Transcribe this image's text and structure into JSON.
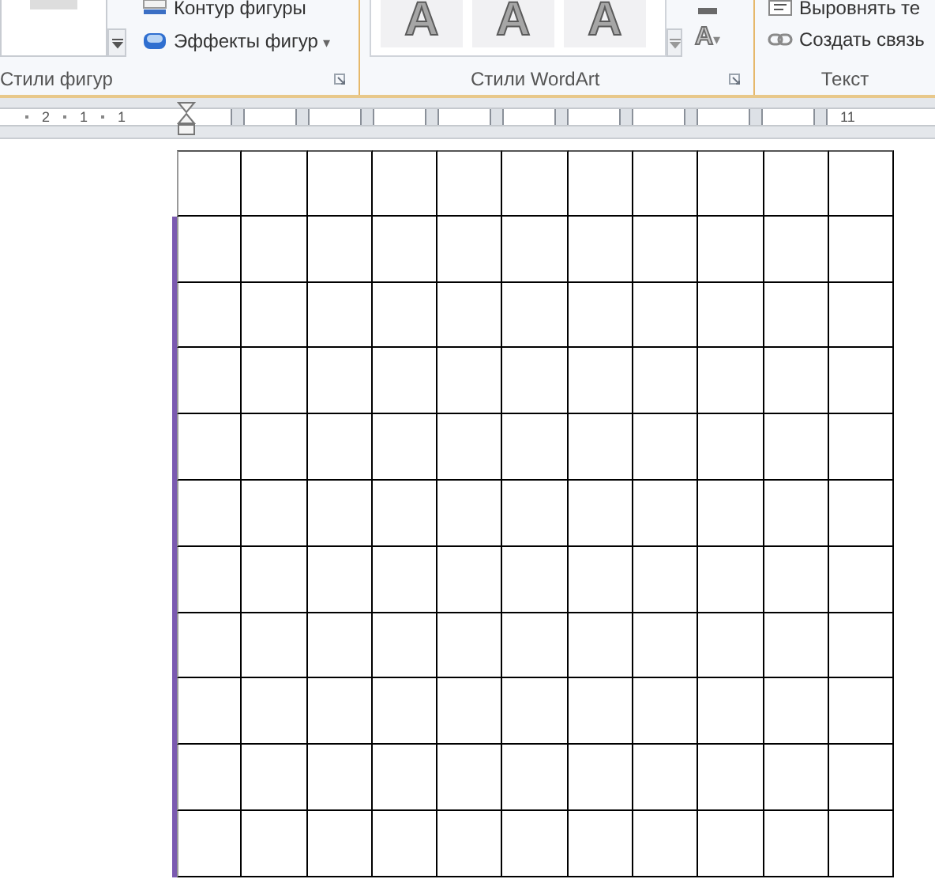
{
  "ribbon": {
    "groups": [
      {
        "label": "Стили фигур",
        "commands": [
          {
            "kind": "outline",
            "label": "Контур фигуры"
          },
          {
            "kind": "effects",
            "label": "Эффекты фигур",
            "dropdown": "▾"
          }
        ]
      },
      {
        "label": "Стили WordArt",
        "tiles": [
          "A",
          "A",
          "A"
        ],
        "fill_button": {
          "label": "A",
          "dropdown": "▾"
        }
      },
      {
        "label": "Текст",
        "commands": [
          {
            "kind": "align",
            "label": "Выровнять те"
          },
          {
            "kind": "link",
            "label": "Создать связь"
          }
        ]
      }
    ]
  },
  "ruler": {
    "left_labels": [
      "2",
      "1",
      "1"
    ],
    "right_label": "11"
  },
  "table": {
    "rows": [
      {
        "marked": false
      },
      {
        "marked": true
      },
      {
        "marked": true
      },
      {
        "marked": true
      },
      {
        "marked": true
      },
      {
        "marked": true
      },
      {
        "marked": true
      },
      {
        "marked": true
      },
      {
        "marked": true
      },
      {
        "marked": true
      },
      {
        "marked": true
      }
    ]
  }
}
